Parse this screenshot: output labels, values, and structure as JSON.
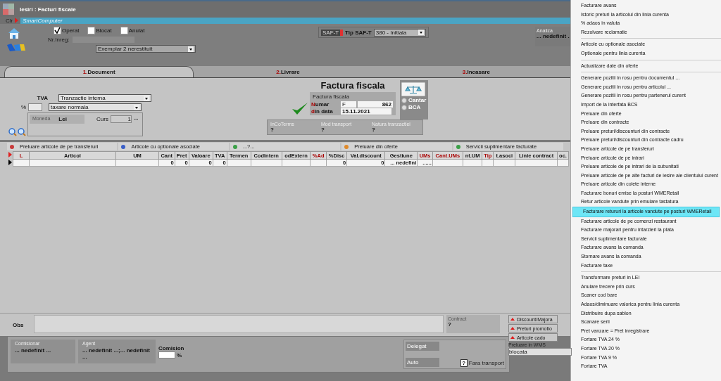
{
  "window": {
    "title": "Iesiri : Facturi fiscale"
  },
  "breadcrumb": {
    "clear": "Clr",
    "company": "SmartComputer"
  },
  "checkboxes": [
    {
      "label": "Operat",
      "checked": true
    },
    {
      "label": "Blocat",
      "checked": false
    },
    {
      "label": "Anulat",
      "checked": false
    }
  ],
  "nr_inreg": {
    "label": "Nr.Inreg:"
  },
  "exemplar": {
    "value": "Exemplar 2 nerestituit"
  },
  "saft": {
    "badge": "SAF-T",
    "label": "Tip SAF-T",
    "value": "380 - Initiala"
  },
  "analiza": {
    "label": "Analiza",
    "value": "... nedefinit ."
  },
  "tabs": [
    {
      "num": "1.",
      "label": "Document",
      "selected": true
    },
    {
      "num": "2.",
      "label": "Livrare",
      "selected": false
    },
    {
      "num": "3.",
      "label": "Incasare",
      "selected": false
    }
  ],
  "tva": {
    "label": "TVA",
    "regime": "Tranzactie interna",
    "percent_label": "%",
    "taxare": "taxare normala"
  },
  "moneda": {
    "label": "Moneda",
    "value": "Lei",
    "curs_label": "Curs",
    "curs": "1",
    "more": "..."
  },
  "document": {
    "heading": "Factura fiscala",
    "box_title": "Factura fiscala",
    "numar_accent": "N",
    "numar_rest": "umar",
    "serie": "F",
    "numar": "862",
    "data_accent": "d",
    "data_rest": "in data",
    "data": "15.11.2021"
  },
  "scale_options": [
    {
      "label": "Cantar",
      "selected": false
    },
    {
      "label": "BCA",
      "selected": false
    }
  ],
  "info": [
    {
      "label": "InCoTerms",
      "value": "?"
    },
    {
      "label": "Mod transport",
      "value": "?"
    },
    {
      "label": "Natura tranzactiei",
      "value": "?"
    }
  ],
  "actions": [
    {
      "label": "Preluare articole de pe transferuri",
      "color": "#c83a3a"
    },
    {
      "label": "Articole cu optionale asociate",
      "color": "#3a5fc8"
    },
    {
      "label": "...?...",
      "color": "#3aa047"
    },
    {
      "label": "Preluare din oferte",
      "color": "#e08a2a"
    },
    {
      "label": "Servicii suplimentare facturate",
      "color": "#3aa047"
    }
  ],
  "table": {
    "columns": [
      {
        "label": "L",
        "red": true
      },
      {
        "label": "Articol",
        "red": false
      },
      {
        "label": "UM",
        "red": false
      },
      {
        "label": "Cant",
        "red": false
      },
      {
        "label": "Pret",
        "red": false
      },
      {
        "label": "Valoare",
        "red": false
      },
      {
        "label": "TVA",
        "red": false
      },
      {
        "label": "Termen",
        "red": false
      },
      {
        "label": "CodIntern",
        "red": false
      },
      {
        "label": "odExtern",
        "red": false
      },
      {
        "label": "%Ad",
        "red": true
      },
      {
        "label": "%Disc",
        "red": false
      },
      {
        "label": "Val.discount",
        "red": false
      },
      {
        "label": "Gestiune",
        "red": false
      },
      {
        "label": "UMs",
        "red": true
      },
      {
        "label": "Cant.UMs",
        "red": true
      },
      {
        "label": "nt.UM",
        "red": false
      },
      {
        "label": "Tip",
        "red": true
      },
      {
        "label": "t.asoci",
        "red": false
      },
      {
        "label": "Linie contract",
        "red": false
      },
      {
        "label": "oc.",
        "red": false
      }
    ],
    "rows": [
      {
        "cells": [
          null,
          null,
          null,
          "0",
          "0",
          "0",
          "0",
          null,
          null,
          null,
          null,
          "0",
          "0",
          "... nedefini",
          "......",
          null,
          null,
          null,
          null,
          null,
          null
        ]
      }
    ]
  },
  "obs": {
    "label": "Obs"
  },
  "contract": {
    "label": "Contract",
    "value": "?"
  },
  "side_buttons": [
    "Discount/Majora",
    "Preturi promotio",
    "Articole cado"
  ],
  "wms": {
    "label": "Preluare in WMS",
    "value": "blocata"
  },
  "comisionar": {
    "label": "Comisionar",
    "value": "... nedefinit ..."
  },
  "agent": {
    "label": "Agent",
    "value": "... nedefinit ...;... nedefinit ..."
  },
  "comision": {
    "label": "Comision",
    "unit": "%"
  },
  "delegat": {
    "label": "Delegat"
  },
  "auto": {
    "label": "Auto"
  },
  "transport": {
    "mark": "?",
    "indeterminate": true,
    "label": "Fara transport"
  },
  "menu": [
    [
      {
        "label": "Facturare avans",
        "selected": false
      },
      {
        "label": "Istoric preturi la articolul din linia curenta",
        "selected": false
      },
      {
        "label": "% adaos in valuta",
        "selected": false
      },
      {
        "label": "Rezolvare reclamatie",
        "selected": false
      }
    ],
    [
      {
        "label": "Articole cu optionale asociate",
        "selected": false
      },
      {
        "label": "Optionale pentru linia curenta",
        "selected": false
      }
    ],
    [
      {
        "label": "Actualizare date din oferte",
        "selected": false
      }
    ],
    [
      {
        "label": "Generare pozitii in rosu pentru documentul ...",
        "selected": false
      },
      {
        "label": "Generare pozitii in rosu pentru articolul ...",
        "selected": false
      },
      {
        "label": "Generare pozitii in rosu pentru partenerul curent",
        "selected": false
      },
      {
        "label": "Import de la interfata BCS",
        "selected": false
      },
      {
        "label": "Preluare din oferte",
        "selected": false
      },
      {
        "label": "Preluare din contracte",
        "selected": false
      },
      {
        "label": "Preluare preturi/discounturi  din contracte",
        "selected": false
      },
      {
        "label": "Preluare preturi/discounturi din contracte cadru",
        "selected": false
      },
      {
        "label": "Preluare articole de pe transferuri",
        "selected": false
      },
      {
        "label": "Preluare articole de pe intrari",
        "selected": false
      },
      {
        "label": "Preluare articole de pe intrari de la subunitati",
        "selected": false
      },
      {
        "label": "Preluare articole de pe alte facturi de iesire ale clientului curent",
        "selected": false
      },
      {
        "label": "Preluare articole din colete interne",
        "selected": false
      },
      {
        "label": "Facturare bonuri emise la posturi  WMERetail",
        "selected": false
      },
      {
        "label": "Retur articole vandute prin emulare tastatura",
        "selected": false
      },
      {
        "label": "Facturare retururi la articole vandute pe posturi WMERetail",
        "selected": true
      },
      {
        "label": "Facturare articole de pe comenzi restaurant",
        "selected": false
      },
      {
        "label": "Facturare majorari pentru intarzieri la plata",
        "selected": false
      },
      {
        "label": "Servicii suplimentare facturate",
        "selected": false
      },
      {
        "label": "Facturare avans la comanda",
        "selected": false
      },
      {
        "label": "Stornare avans la comanda",
        "selected": false
      },
      {
        "label": "Facturare taxe",
        "selected": false
      }
    ],
    [
      {
        "label": "Transformare preturi in LEI",
        "selected": false
      },
      {
        "label": "Anulare trecere prin curs",
        "selected": false
      },
      {
        "label": "Scaner cod bare",
        "selected": false
      },
      {
        "label": "Adaos/diminuare valorica pentru linia curenta",
        "selected": false
      },
      {
        "label": "Distribuire dupa sablon",
        "selected": false
      },
      {
        "label": "Scanare serii",
        "selected": false
      },
      {
        "label": "Pret vanzare = Pret inregistrare",
        "selected": false
      },
      {
        "label": "Fortare TVA 24 %",
        "selected": false
      },
      {
        "label": "Fortare TVA 20 %",
        "selected": false
      },
      {
        "label": "Fortare TVA 9 %",
        "selected": false
      },
      {
        "label": "Fortare TVA",
        "selected": false
      }
    ]
  ]
}
